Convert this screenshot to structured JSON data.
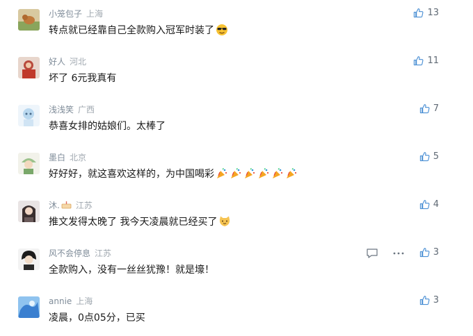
{
  "comments": [
    {
      "user": "小笼包子",
      "location": "上海",
      "text": "转点就已经靠自己全款购入冠军时装了",
      "emoji": "sunglasses-emoji",
      "likes": "13",
      "avatar_color": "#c9b27a"
    },
    {
      "user": "好人",
      "location": "河北",
      "text": "坏了 6元我真有",
      "likes": "11",
      "avatar_color": "#b84a3c"
    },
    {
      "user": "浅浅笑",
      "location": "广西",
      "text": "恭喜女排的姑娘们。太棒了",
      "likes": "7",
      "avatar_color": "#b9d8ef"
    },
    {
      "user": "墨白",
      "location": "北京",
      "text": "好好好，就这喜欢这样的，为中国喝彩",
      "emoji": "party-popper-emoji",
      "likes": "5",
      "avatar_color": "#9cc28c"
    },
    {
      "user": "沐.",
      "location": "江苏",
      "text": "推文发得太晚了 我今天凌晨就已经买了",
      "emoji": "cat-face-emoji",
      "likes": "4",
      "avatar_color": "#6a5a5a"
    },
    {
      "user": "风不会停息",
      "location": "江苏",
      "text": "全款购入，没有一丝丝犹豫！就是壕！",
      "likes": "3",
      "avatar_color": "#2a2a2a"
    },
    {
      "user": "annie",
      "location": "上海",
      "text": "凌晨，0点05分，已买",
      "likes": "3",
      "avatar_color": "#4a8fd4"
    }
  ]
}
